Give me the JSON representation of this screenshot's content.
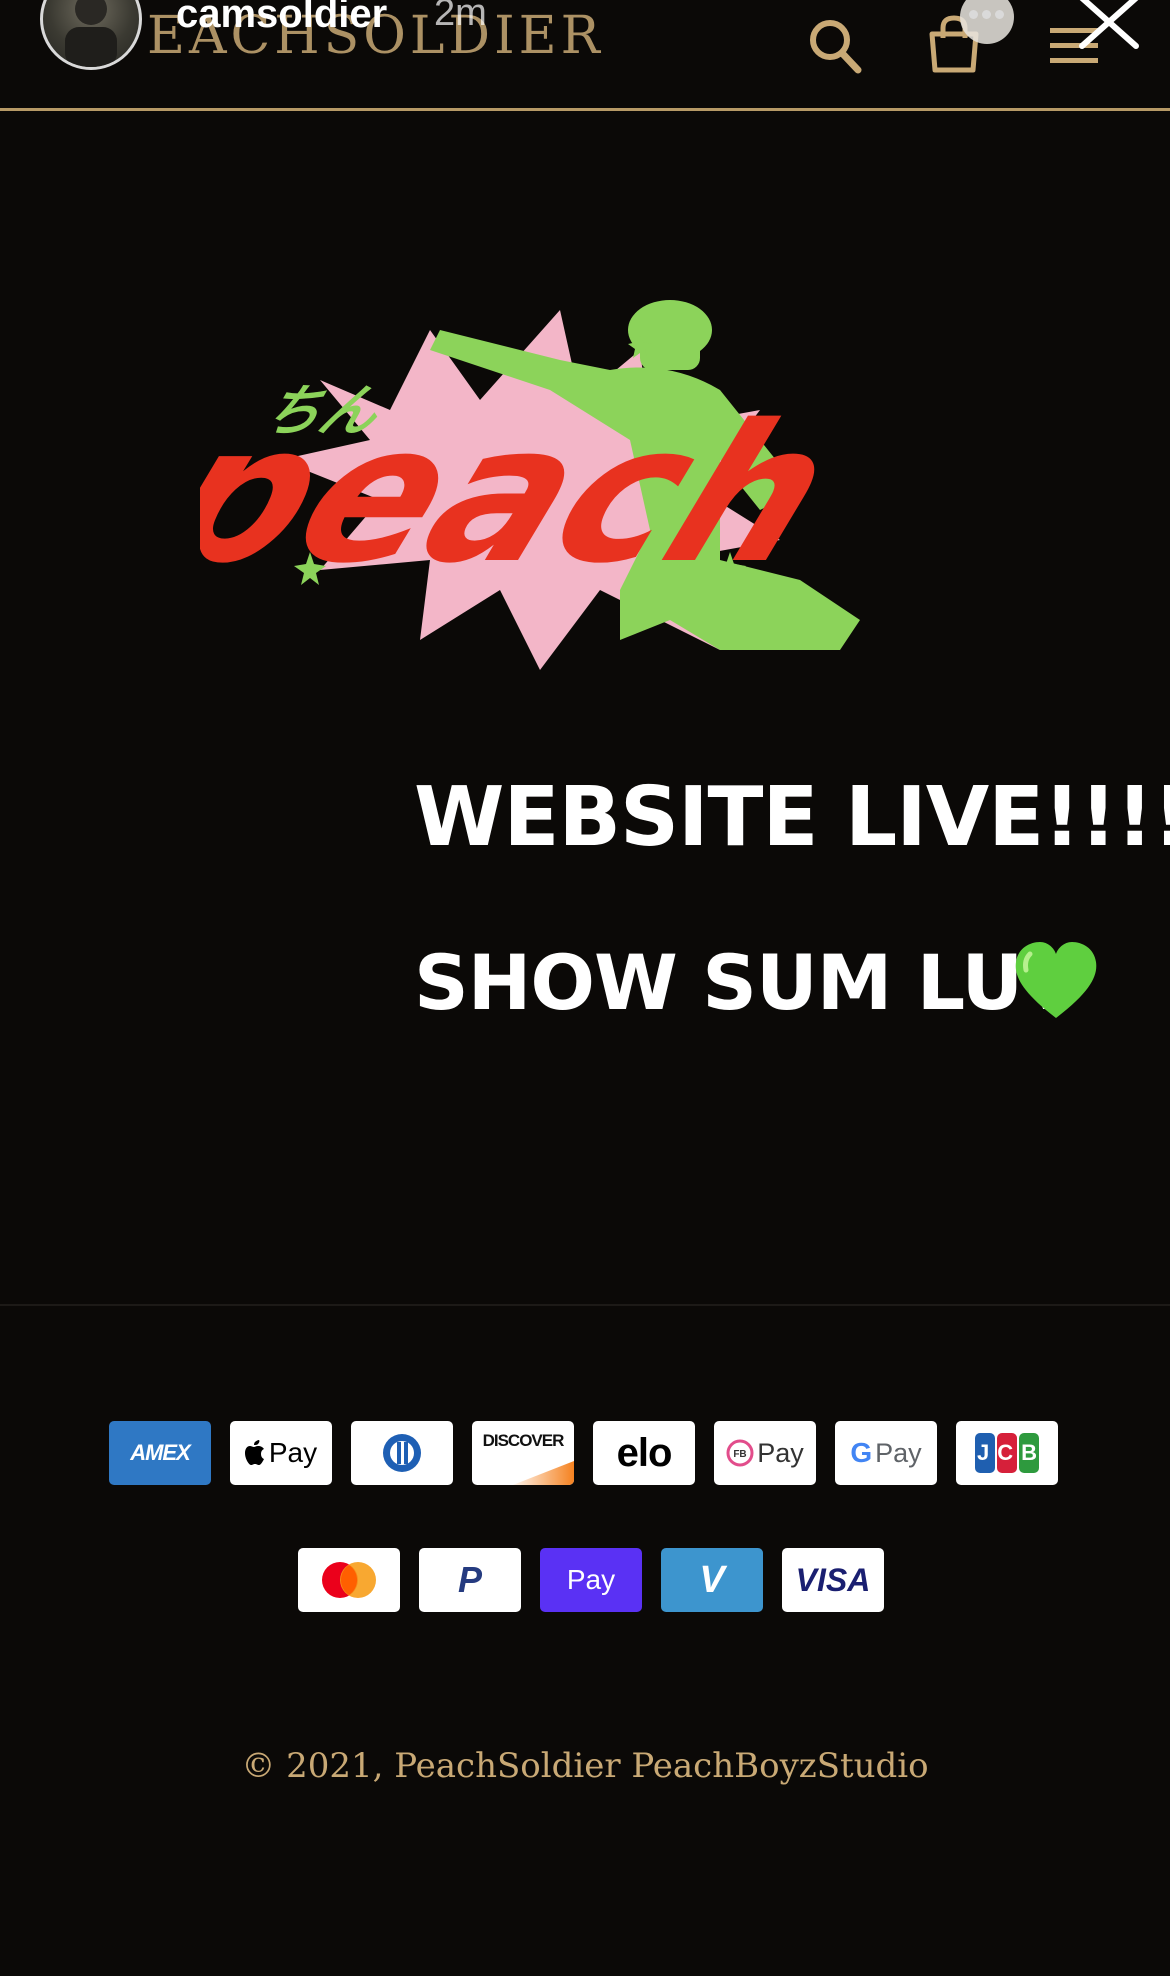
{
  "story": {
    "username": "camsoldier",
    "timestamp": "2m"
  },
  "header": {
    "store_title": "PEACHSOLDIER",
    "icons": [
      "search-icon",
      "cart-icon",
      "menu-icon"
    ]
  },
  "hero": {
    "logo_small_text": "ちん",
    "logo_word": "peach"
  },
  "announcement": {
    "line1": "WEBSITE LIVE!!!!!",
    "line2": "SHOW SUM LUV",
    "emoji": "green-heart"
  },
  "payments": {
    "row1": [
      {
        "id": "amex",
        "label": "AMEX"
      },
      {
        "id": "apple-pay",
        "label": "Pay"
      },
      {
        "id": "diners",
        "label": ""
      },
      {
        "id": "discover",
        "label": "DISCOVER"
      },
      {
        "id": "elo",
        "label": "elo"
      },
      {
        "id": "fb-pay",
        "label": "Pay"
      },
      {
        "id": "google-pay",
        "label": "Pay"
      },
      {
        "id": "jcb",
        "label": "JCB"
      }
    ],
    "row2": [
      {
        "id": "mastercard",
        "label": ""
      },
      {
        "id": "paypal",
        "label": "P"
      },
      {
        "id": "shop-pay",
        "label": "Pay"
      },
      {
        "id": "venmo",
        "label": "V"
      },
      {
        "id": "visa",
        "label": "VISA"
      }
    ]
  },
  "footer": {
    "copyright": "© 2021, PeachSoldier PeachBoyzStudio"
  },
  "colors": {
    "background": "#0b0907",
    "gold": "#c9a975",
    "logo_red": "#e8321f",
    "logo_green": "#8cd35a",
    "logo_pink": "#f3b6c8"
  }
}
